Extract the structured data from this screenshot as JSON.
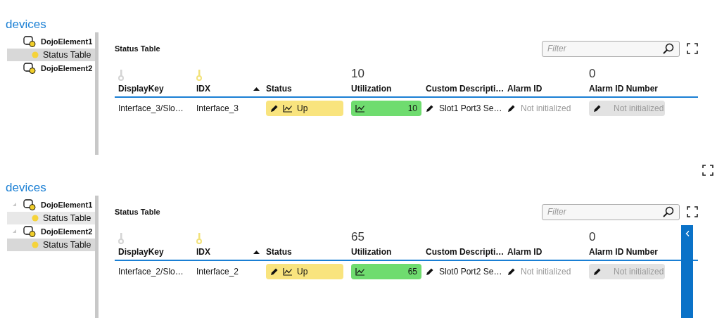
{
  "panels": [
    {
      "title": "devices",
      "side_tab": false,
      "tree": [
        {
          "label": "DojoElement1",
          "expander": false,
          "children": [
            {
              "label": "Status Table",
              "selected": true
            }
          ]
        },
        {
          "label": "DojoElement2",
          "expander": false
        }
      ],
      "content": {
        "title": "Status Table",
        "filter": {
          "placeholder": "Filter"
        },
        "summary": [
          {
            "kind": "key",
            "color": "#d4d4d4"
          },
          {
            "kind": "key",
            "color": "#f2e27a"
          },
          {
            "kind": "empty"
          },
          {
            "kind": "value",
            "text": "10"
          },
          {
            "kind": "empty"
          },
          {
            "kind": "empty"
          },
          {
            "kind": "value",
            "text": "0"
          }
        ],
        "columns": [
          {
            "label": "DisplayKey",
            "sorted": false
          },
          {
            "label": "IDX",
            "sorted": false
          },
          {
            "label": "Status",
            "sorted": true
          },
          {
            "label": "Utilization",
            "sorted": false
          },
          {
            "label": "Custom Descripti…",
            "sorted": false
          },
          {
            "label": "Alarm ID",
            "sorted": false
          },
          {
            "label": "Alarm ID Number",
            "sorted": false
          }
        ],
        "rows": [
          [
            {
              "kind": "text",
              "text": "Interface_3/Slo…"
            },
            {
              "kind": "text",
              "text": "Interface_3"
            },
            {
              "kind": "status",
              "text": "Up",
              "color": "#f9e47e"
            },
            {
              "kind": "meter",
              "text": "10",
              "color": "#6fdc6f"
            },
            {
              "kind": "edit",
              "text": "Slot1 Port3 Se…",
              "disabled": false
            },
            {
              "kind": "edit",
              "text": "Not initialized",
              "disabled": true
            },
            {
              "kind": "editbox",
              "text": "Not initialized",
              "disabled": true
            }
          ]
        ]
      }
    },
    {
      "title": "devices",
      "side_tab": true,
      "tree": [
        {
          "label": "DojoElement1",
          "expander": true,
          "children": [
            {
              "label": "Status Table",
              "selected": false,
              "highlighted": true
            }
          ]
        },
        {
          "label": "DojoElement2",
          "expander": true,
          "children": [
            {
              "label": "Status Table",
              "selected": true
            }
          ]
        }
      ],
      "content": {
        "title": "Status Table",
        "filter": {
          "placeholder": "Filter"
        },
        "summary": [
          {
            "kind": "key",
            "color": "#d4d4d4"
          },
          {
            "kind": "key",
            "color": "#f2e27a"
          },
          {
            "kind": "empty"
          },
          {
            "kind": "value",
            "text": "65"
          },
          {
            "kind": "empty"
          },
          {
            "kind": "empty"
          },
          {
            "kind": "value",
            "text": "0"
          }
        ],
        "columns": [
          {
            "label": "DisplayKey",
            "sorted": false
          },
          {
            "label": "IDX",
            "sorted": false
          },
          {
            "label": "Status",
            "sorted": true
          },
          {
            "label": "Utilization",
            "sorted": false
          },
          {
            "label": "Custom Descripti…",
            "sorted": false
          },
          {
            "label": "Alarm ID",
            "sorted": false
          },
          {
            "label": "Alarm ID Number",
            "sorted": false
          }
        ],
        "rows": [
          [
            {
              "kind": "text",
              "text": "Interface_2/Slo…"
            },
            {
              "kind": "text",
              "text": "Interface_2"
            },
            {
              "kind": "status",
              "text": "Up",
              "color": "#f9e47e"
            },
            {
              "kind": "meter",
              "text": "65",
              "color": "#6fdc6f"
            },
            {
              "kind": "edit",
              "text": "Slot0 Port2 Se…",
              "disabled": false
            },
            {
              "kind": "edit",
              "text": "Not initialized",
              "disabled": true
            },
            {
              "kind": "editbox",
              "text": "Not initialized",
              "disabled": true
            }
          ]
        ]
      }
    }
  ]
}
